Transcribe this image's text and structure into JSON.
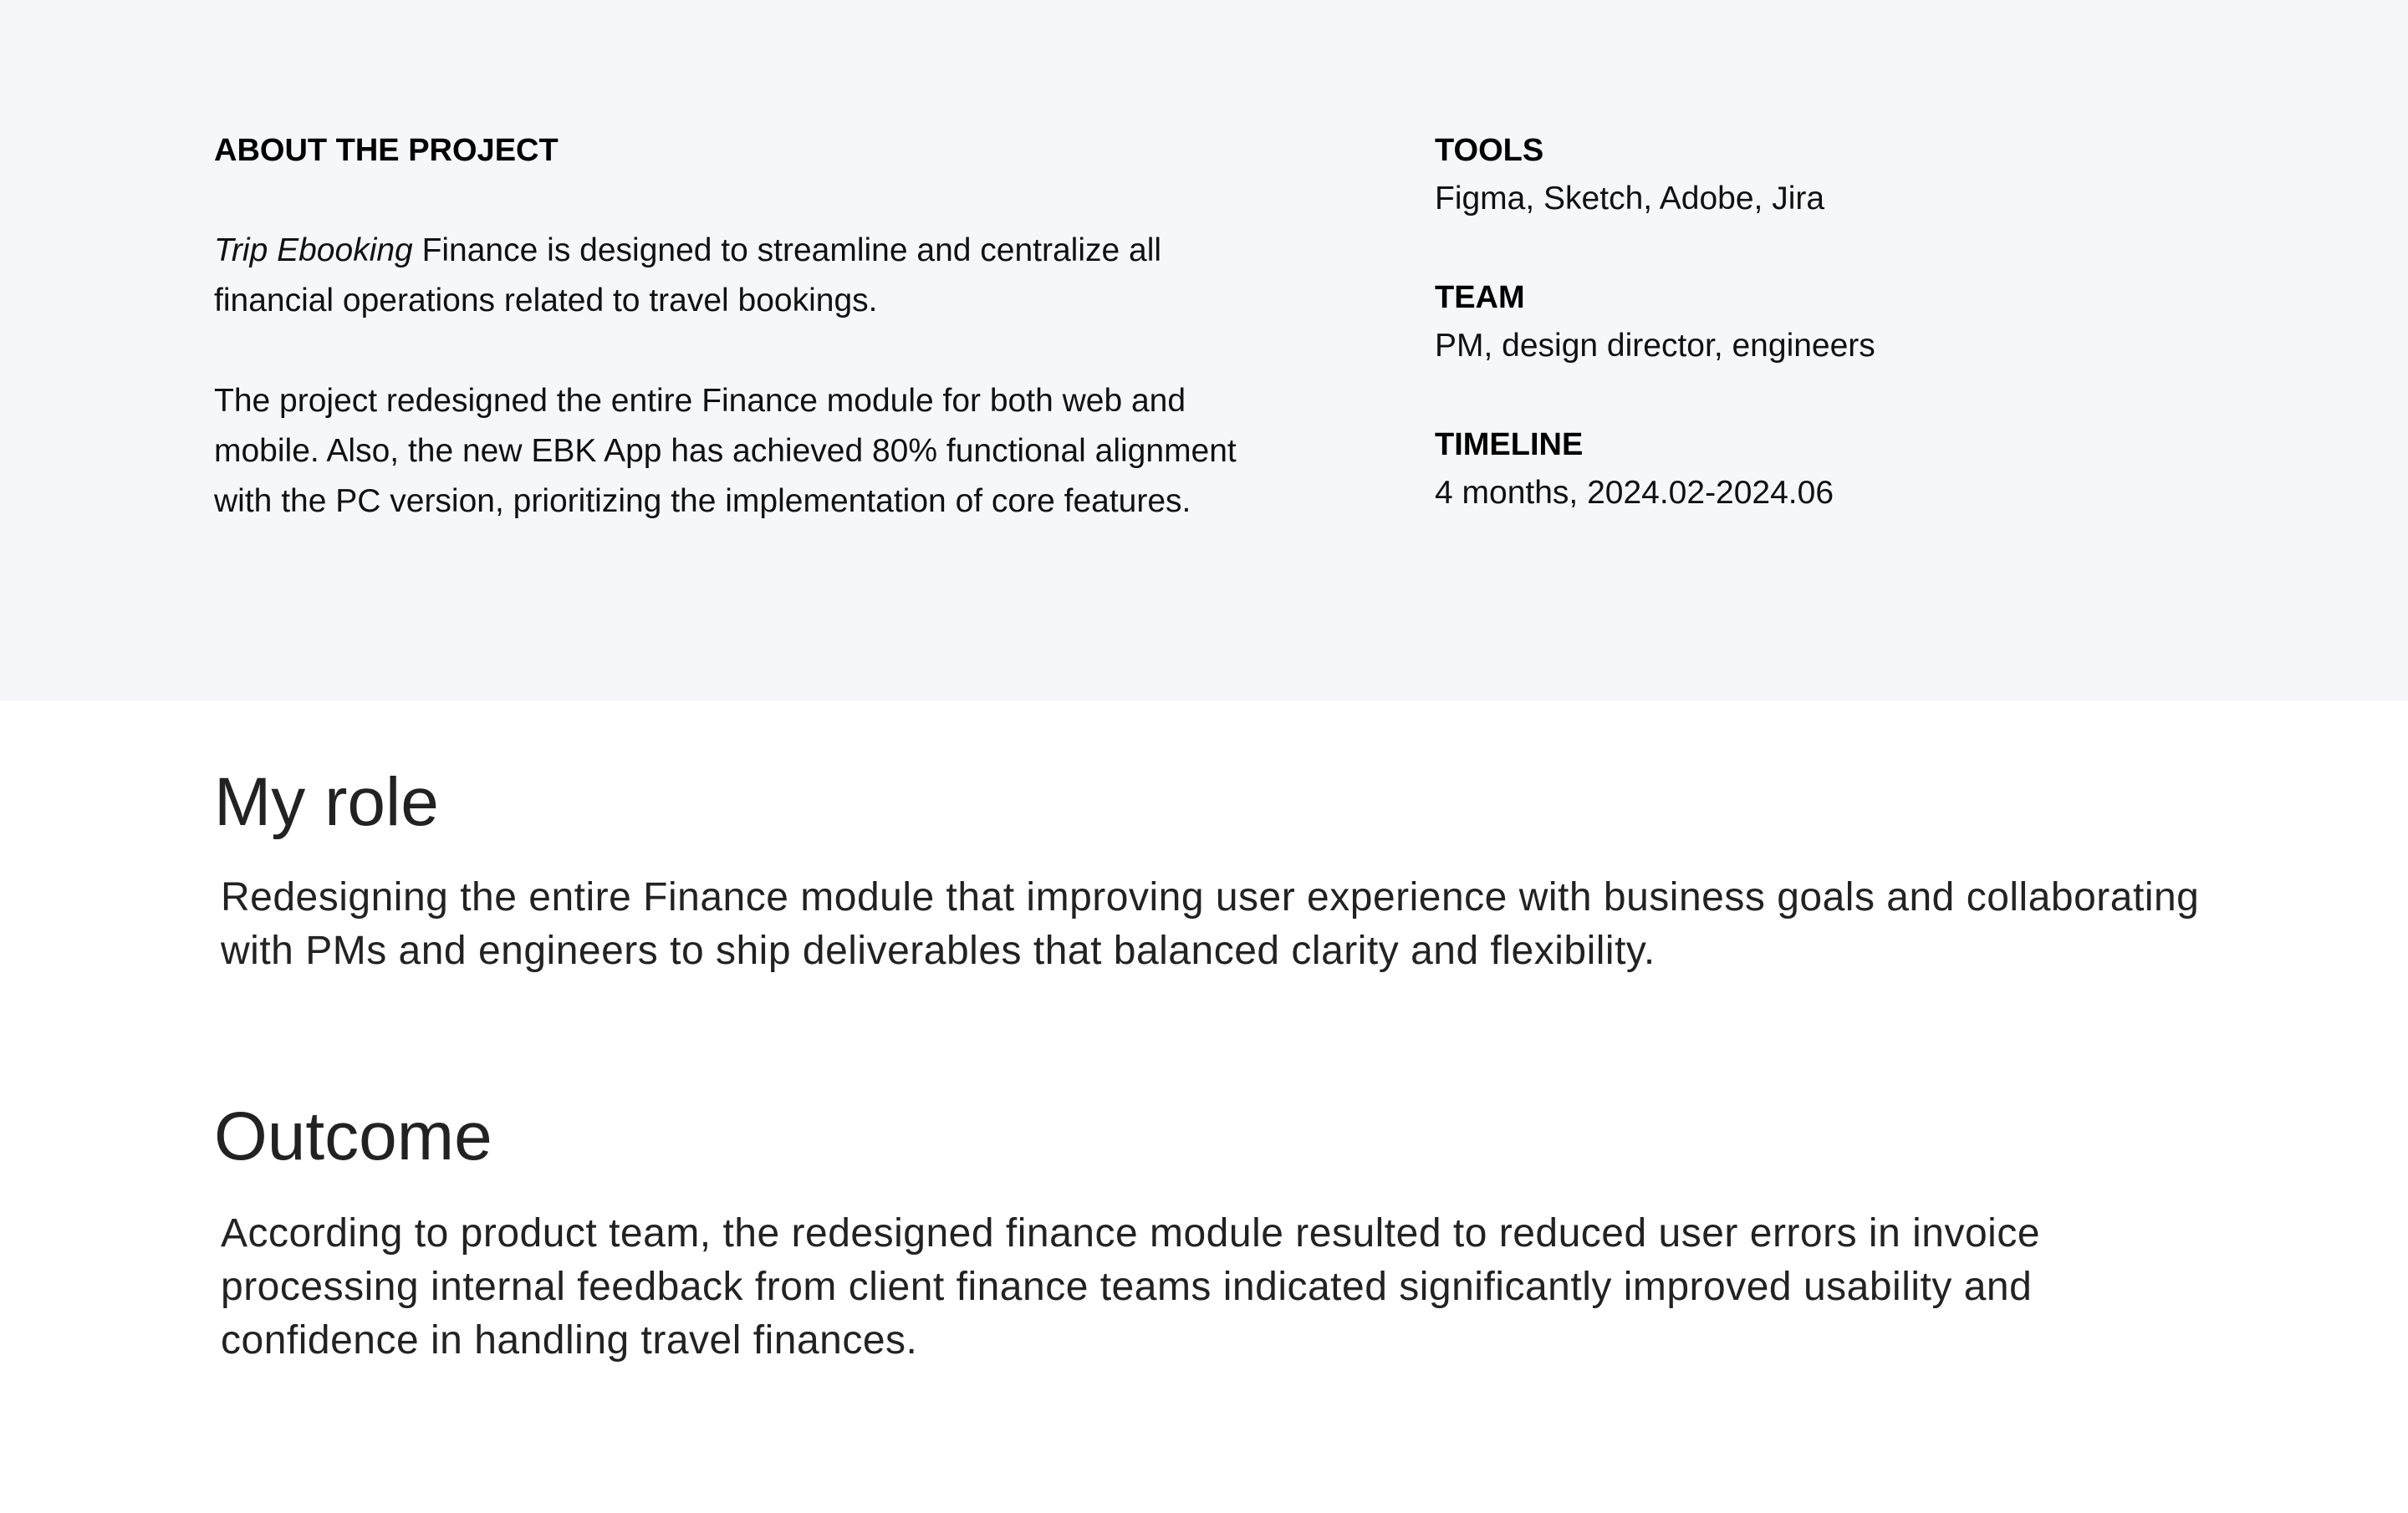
{
  "about": {
    "heading": "ABOUT THE PROJECT",
    "intro_brand": "Trip Ebooking",
    "intro_rest": " Finance is designed to streamline and centralize all financial operations related to travel bookings.",
    "detail": "The project redesigned the entire Finance module for both web and mobile. Also, the new EBK App has achieved 80% functional alignment with the PC version, prioritizing the implementation of core features."
  },
  "meta": {
    "tools_label": "TOOLS",
    "tools_value": "Figma, Sketch, Adobe, Jira",
    "team_label": "TEAM",
    "team_value": "PM, design director, engineers",
    "timeline_label": "TIMELINE",
    "timeline_value": "4 months, 2024.02-2024.06"
  },
  "role": {
    "heading": "My role",
    "text": "Redesigning the entire Finance module that improving user experience with business goals and collaborating with PMs and engineers to ship deliverables that balanced clarity and flexibility."
  },
  "outcome": {
    "heading": "Outcome",
    "text": "According to product team, the redesigned finance module resulted to reduced user errors in invoice processing internal feedback from client finance teams indicated significantly improved usability and confidence in handling travel finances."
  },
  "colors": {
    "about_background": "#f6f7f9",
    "page_background": "#ffffff",
    "text": "#1a1a1a"
  }
}
